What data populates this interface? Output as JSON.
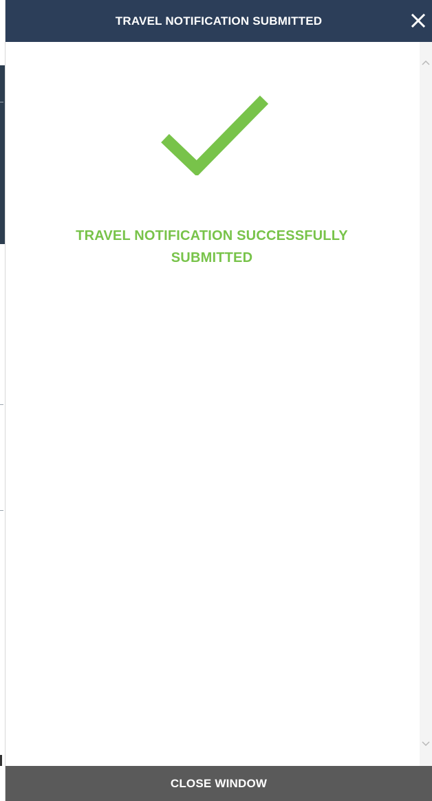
{
  "modal": {
    "title": "TRAVEL NOTIFICATION SUBMITTED",
    "close_icon": "close-icon",
    "success_icon": "checkmark-icon",
    "message": "TRAVEL NOTIFICATION SUCCESSFULLY SUBMITTED",
    "footer_button_label": "CLOSE WINDOW"
  },
  "scrollbar": {
    "up_icon": "chevron-up-icon",
    "down_icon": "chevron-down-icon"
  },
  "colors": {
    "header_bg": "#2c3e59",
    "success_green": "#78c34a",
    "footer_bg": "#5a5a5a",
    "text_on_dark": "#ffffff"
  }
}
